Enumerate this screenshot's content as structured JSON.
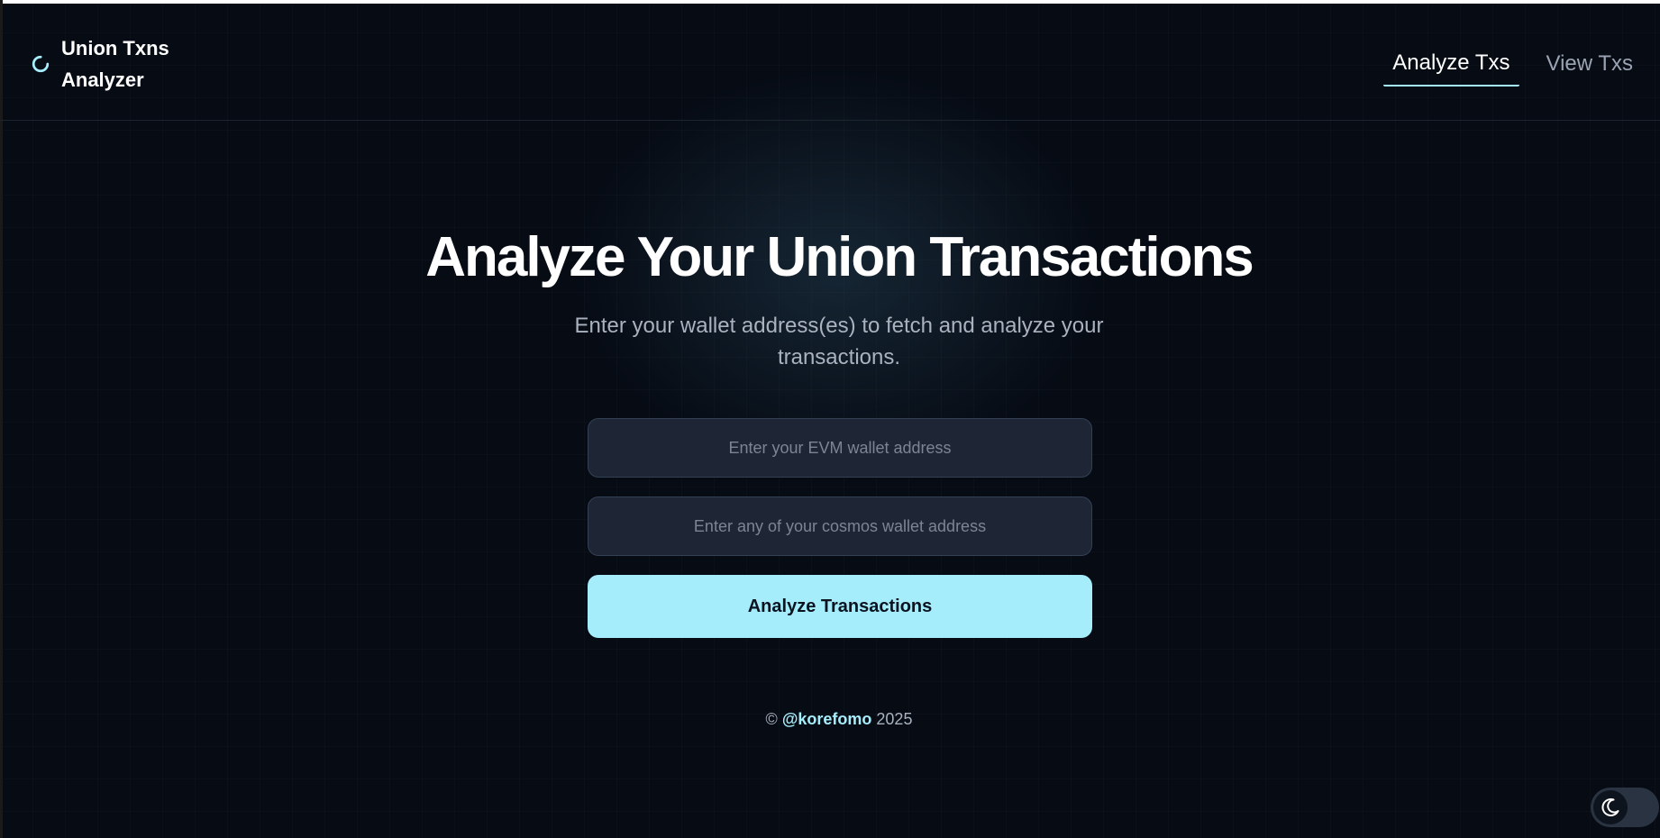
{
  "header": {
    "brand_title": "Union Txns Analyzer",
    "logo_icon": "loading-ring-icon",
    "nav": [
      {
        "label": "Analyze Txs",
        "active": true
      },
      {
        "label": "View Txs",
        "active": false
      }
    ]
  },
  "main": {
    "title": "Analyze Your Union Transactions",
    "subtitle": "Enter your wallet address(es) to fetch and analyze your transactions.",
    "evm_input": {
      "value": "",
      "placeholder": "Enter your EVM wallet address"
    },
    "cosmos_input": {
      "value": "",
      "placeholder": "Enter any of your cosmos wallet address"
    },
    "submit_label": "Analyze Transactions"
  },
  "footer": {
    "copyright_symbol": "©",
    "handle": "@korefomo",
    "year": "2025"
  },
  "theme_toggle": {
    "icon": "moon-icon"
  },
  "colors": {
    "accent": "#a5edfb",
    "background": "#060b14",
    "input_bg": "#1e2635"
  }
}
